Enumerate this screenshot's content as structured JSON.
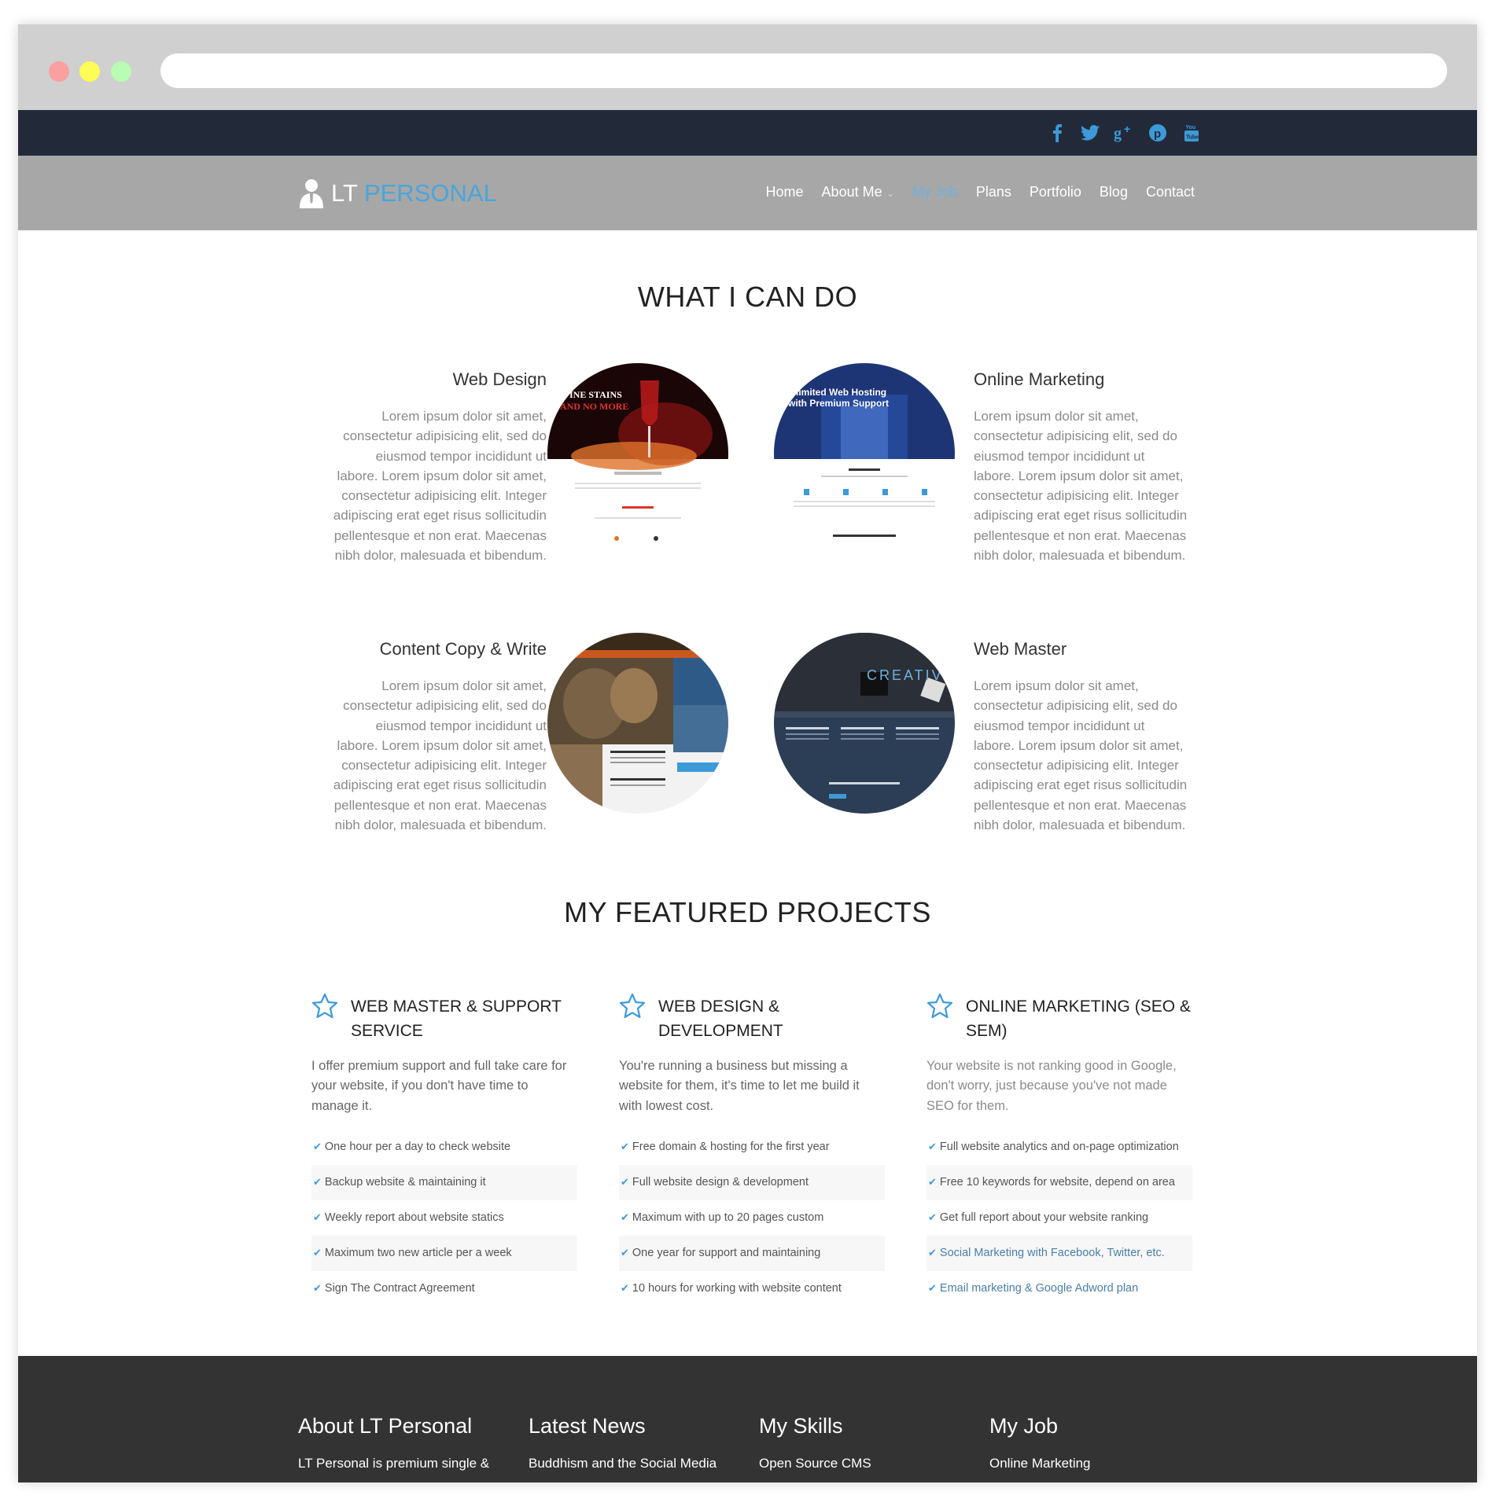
{
  "topbar": {
    "social": [
      "facebook-icon",
      "twitter-icon",
      "google-plus-icon",
      "pinterest-icon",
      "youtube-icon"
    ]
  },
  "brand": {
    "lt": "LT",
    "personal": "PERSONAL"
  },
  "nav": {
    "home": "Home",
    "about": "About Me",
    "myjob": "My Job",
    "plans": "Plans",
    "portfolio": "Portfolio",
    "blog": "Blog",
    "contact": "Contact"
  },
  "what_i_can_do": {
    "title": "WHAT I CAN DO",
    "services": [
      {
        "title": "Web Design",
        "text": "Lorem ipsum dolor sit amet, consectetur adipisicing elit, sed do eiusmod tempor incididunt ut labore. Lorem ipsum dolor sit amet, consectetur adipisicing elit. Integer adipiscing erat eget risus sollicitudin pellentesque et non erat. Maecenas nibh dolor, malesuada et bibendum."
      },
      {
        "title": "Online Marketing",
        "text": "Lorem ipsum dolor sit amet, consectetur adipisicing elit, sed do eiusmod tempor incididunt ut labore. Lorem ipsum dolor sit amet, consectetur adipisicing elit. Integer adipiscing erat eget risus sollicitudin pellentesque et non erat. Maecenas nibh dolor, malesuada et bibendum."
      },
      {
        "title": "Content Copy & Write",
        "text": "Lorem ipsum dolor sit amet, consectetur adipisicing elit, sed do eiusmod tempor incididunt ut labore. Lorem ipsum dolor sit amet, consectetur adipisicing elit. Integer adipiscing erat eget risus sollicitudin pellentesque et non erat. Maecenas nibh dolor, malesuada et bibendum."
      },
      {
        "title": "Web Master",
        "text": "Lorem ipsum dolor sit amet, consectetur adipisicing elit, sed do eiusmod tempor incididunt ut labore. Lorem ipsum dolor sit amet, consectetur adipisicing elit. Integer adipiscing erat eget risus sollicitudin pellentesque et non erat. Maecenas nibh dolor, malesuada et bibendum."
      }
    ],
    "thumbs": {
      "wine_line1": "INE STAINS",
      "wine_line2": "AND NO MORE",
      "hosting_line1": "limited Web Hosting",
      "hosting_line2": "with Premium Support",
      "creative": "CREATIV"
    }
  },
  "featured": {
    "title": "MY FEATURED PROJECTS",
    "projects": [
      {
        "title": "WEB MASTER & SUPPORT SERVICE",
        "desc": "I offer premium support and full take care for your website, if you don't have time to manage it.",
        "items": [
          "One hour per a day to check website",
          "Backup website & maintaining it",
          "Weekly report about website statics",
          "Maximum two new article per a week",
          "Sign The Contract Agreement"
        ]
      },
      {
        "title": "WEB DESIGN & DEVELOPMENT",
        "desc": "You're running a business but missing a website for them, it's time to let me build it with lowest cost.",
        "items": [
          "Free domain & hosting for the first year",
          "Full website design & development",
          "Maximum with up to 20 pages custom",
          "One year for support and maintaining",
          "10 hours for working with website content"
        ]
      },
      {
        "title": "ONLINE MARKETING (SEO & SEM)",
        "desc": "Your website is not ranking good in Google, don't worry, just because you've not made SEO for them.",
        "items": [
          "Full website analytics and on-page optimization",
          "Free 10 keywords for website, depend on area",
          "Get full report about your website ranking",
          "Social Marketing with Facebook, Twitter, etc.",
          "Email marketing & Google Adword plan"
        ]
      }
    ]
  },
  "footer": {
    "cols": [
      {
        "title": "About LT Personal",
        "first": "LT Personal is premium single &"
      },
      {
        "title": "Latest News",
        "first": "Buddhism and the Social Media"
      },
      {
        "title": "My Skills",
        "first": "Open Source CMS"
      },
      {
        "title": "My Job",
        "first": "Online Marketing"
      }
    ]
  },
  "colors": {
    "accent": "#4aa5dc",
    "topbar": "#222a3a",
    "navbar": "#a7a7a7",
    "footer": "#333333"
  }
}
